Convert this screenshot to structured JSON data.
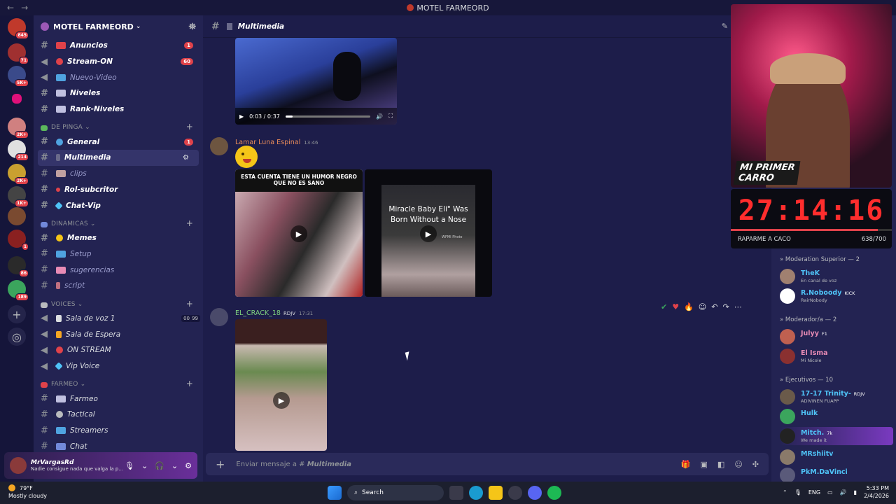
{
  "window": {
    "title": "MOTEL FARMEORD"
  },
  "servers": [
    {
      "badge": "845"
    },
    {
      "badge": "71"
    },
    {
      "badge": "5K+"
    },
    {
      "badge": ""
    },
    {
      "badge": "2K+"
    },
    {
      "badge": "214"
    },
    {
      "badge": "2K+"
    },
    {
      "badge": "1K+"
    },
    {
      "badge": ""
    },
    {
      "badge": "1"
    },
    {
      "badge": "86"
    },
    {
      "badge": "189"
    }
  ],
  "server": {
    "name": "MOTEL FARMEORD"
  },
  "channels_top": [
    {
      "name": "Anuncios",
      "badge": "1"
    },
    {
      "name": "Stream-ON",
      "badge": "60"
    },
    {
      "name": "Nuevo-Video",
      "badge": ""
    },
    {
      "name": "Niveles",
      "badge": ""
    },
    {
      "name": "Rank-Niveles",
      "badge": ""
    }
  ],
  "categories": {
    "de_pinga": "DE PINGA",
    "dinamicas": "DINAMICAS",
    "voices": "VOICES",
    "farmeo": "FARMEO"
  },
  "channels_de_pinga": [
    {
      "name": "General",
      "badge": "1"
    },
    {
      "name": "Multimedia",
      "badge": ""
    },
    {
      "name": "clips",
      "badge": ""
    },
    {
      "name": "Rol-subcritor",
      "badge": ""
    },
    {
      "name": "Chat-Vip",
      "badge": ""
    }
  ],
  "channels_dinamicas": [
    {
      "name": "Memes"
    },
    {
      "name": "Setup"
    },
    {
      "name": "sugerencias"
    },
    {
      "name": "script"
    }
  ],
  "channels_voices": [
    {
      "name": "Sala de voz 1",
      "count_a": "00",
      "count_b": "99"
    },
    {
      "name": "Sala de Espera"
    },
    {
      "name": "ON STREAM"
    },
    {
      "name": "Vip Voice"
    }
  ],
  "channels_farmeo": [
    {
      "name": "Farmeo"
    },
    {
      "name": "Tactical"
    },
    {
      "name": "Streamers"
    },
    {
      "name": "Chat"
    }
  ],
  "user": {
    "name": "MrVargasRd",
    "status": "Nadie consigue nada que valga la p..."
  },
  "channel": {
    "name": "Multimedia"
  },
  "video": {
    "time": "0:03 / 0:37",
    "progress": 0.08
  },
  "messages": [
    {
      "user": "Lamar Luna Espinal",
      "time": "13:46"
    },
    {
      "user": "EL_CRACK_18",
      "tag": "RDJV",
      "time": "17:31"
    }
  ],
  "tiles": {
    "t1_caption": "ESTA CUENTA TIENE UN HUMOR NEGRO QUE NO ES SANO",
    "t2_caption": "Miracle Baby Eli\" Was Born Without a Nose",
    "t2_watermark": "WFMI Photo"
  },
  "composer": {
    "prefix": "Enviar mensaje a #",
    "channel": "Multimedia"
  },
  "stream": {
    "banner_line1": "MI PRIMER",
    "banner_line2": "CARRO",
    "timer": "27:14:16",
    "goal_label": "RAPARME A CACO",
    "goal_value": "638/700",
    "goal_fraction": 0.911
  },
  "member_groups": [
    "Moderation Superior — 2",
    "Moderador/a — 2",
    "Ejecutivos — 10"
  ],
  "members": [
    {
      "name": "TheK",
      "sub": "En canal de voz",
      "color": "#4fc3f7"
    },
    {
      "name": "R.Noboody",
      "sub": "RairNobody",
      "chip": "KICK",
      "color": "#4fc3f7"
    },
    {
      "name": "Julyy",
      "sub": "",
      "chip": "F1",
      "color": "#e88bb5"
    },
    {
      "name": "El Isma",
      "sub": "Mi Nicole",
      "color": "#e88bb5"
    },
    {
      "name": "17-17 Trinity-",
      "sub": "ADIVINEN FUAPP",
      "chip": "RDJV",
      "color": "#4fc3f7"
    },
    {
      "name": "Hulk",
      "sub": "",
      "color": "#4fc3f7"
    },
    {
      "name": "Mitch.",
      "sub": "We made it",
      "chip": "7k",
      "color": "#4fc3f7"
    },
    {
      "name": "MRshiitv",
      "sub": "",
      "color": "#4fc3f7"
    },
    {
      "name": "PkM.DaVinci",
      "sub": "",
      "color": "#4fc3f7"
    }
  ],
  "taskbar": {
    "temp": "79°F",
    "weather": "Mostly cloudy",
    "search": "Search",
    "lang": "ENG",
    "time": "5:33 PM",
    "date": "2/4/2026"
  }
}
